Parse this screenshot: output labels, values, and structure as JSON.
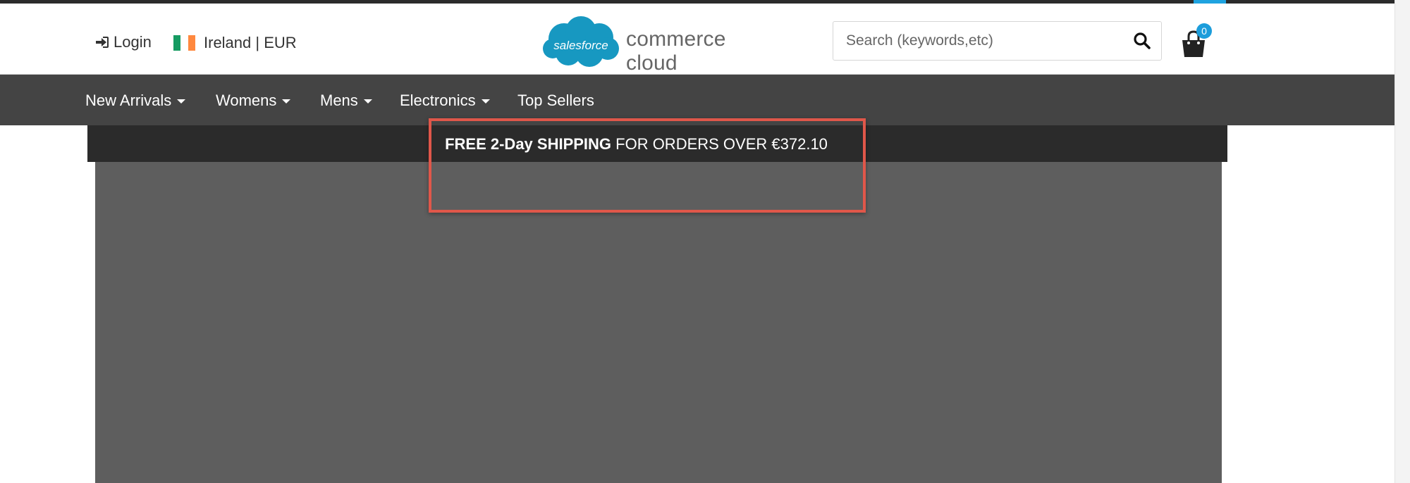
{
  "header": {
    "login_label": "Login",
    "locale_label": "Ireland | EUR",
    "flag_colors": [
      "#169b62",
      "#ffffff",
      "#ff883e"
    ],
    "logo_badge_text": "salesforce",
    "logo_text": "commerce cloud",
    "brand_color": "#1798c1",
    "search": {
      "placeholder": "Search (keywords,etc)",
      "value": ""
    },
    "cart": {
      "count": "0",
      "badge_color": "#1c9ddb"
    }
  },
  "nav": {
    "items": [
      {
        "label": "New Arrivals",
        "has_dropdown": true
      },
      {
        "label": "Womens",
        "has_dropdown": true
      },
      {
        "label": "Mens",
        "has_dropdown": true
      },
      {
        "label": "Electronics",
        "has_dropdown": true
      },
      {
        "label": "Top Sellers",
        "has_dropdown": false
      }
    ]
  },
  "promo": {
    "bold_text": "FREE 2-Day SHIPPING",
    "regular_text": " FOR ORDERS OVER €372.10"
  },
  "colors": {
    "nav_bg": "#444444",
    "promo_bg": "#2b2b2b",
    "hero_bg": "#5e5e5e",
    "highlight_border": "#e0574a"
  },
  "icons": {
    "login": "sign-in-icon",
    "search": "search-icon",
    "cart": "shopping-bag-icon"
  }
}
